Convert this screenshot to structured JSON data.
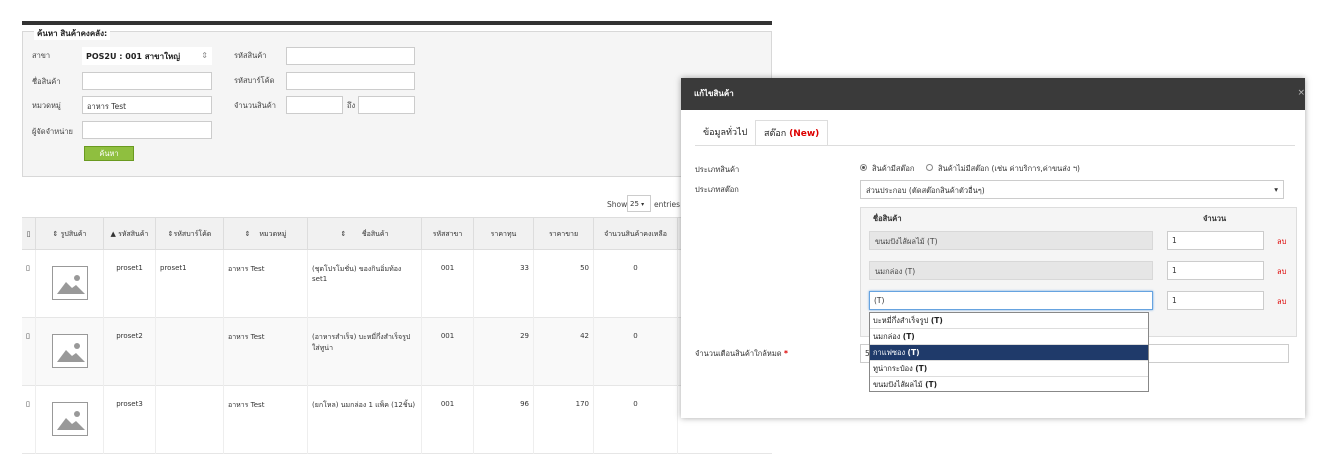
{
  "search": {
    "legend": "ค้นหา สินค้าคงคลัง:",
    "branch_label": "สาขา",
    "branch_value": "POS2U : 001 สาขาใหญ่",
    "name_label": "ชื่อสินค้า",
    "category_label": "หมวดหมู่",
    "category_value": "อาหาร Test",
    "supplier_label": "ผู้จัดจำหน่าย",
    "code_label": "รหัสสินค้า",
    "barcode_label": "รหัสบาร์โค้ด",
    "qty_label": "จำนวนสินค้า",
    "to_label": "ถึง",
    "search_button": "ค้นหา"
  },
  "table": {
    "show_label": "Show",
    "page_size": "25",
    "entries_label": "entries",
    "columns": [
      "รูปสินค้า",
      "รหัสสินค้า",
      "รหัสบาร์โค้ด",
      "หมวดหมู่",
      "ชื่อสินค้า",
      "รหัสสาขา",
      "ราคาทุน",
      "ราคาขาย",
      "จำนวนสินค้าคงเหลือ"
    ],
    "rows": [
      {
        "code": "proset1",
        "barcode": "proset1",
        "category": "อาหาร Test",
        "name": "(ชุดโปรโมชั่น) ของกินอิ่มท้อง set1",
        "branch": "001",
        "cost": "33",
        "price": "50",
        "stock": "0"
      },
      {
        "code": "proset2",
        "barcode": "",
        "category": "อาหาร Test",
        "name": "(อาหารสำเร็จ) บะหมี่กึ่งสำเร็จรูปใส่ทูน่า",
        "branch": "001",
        "cost": "29",
        "price": "42",
        "stock": "0"
      },
      {
        "code": "proset3",
        "barcode": "",
        "category": "อาหาร Test",
        "name": "(ยกโหล) นมกล่อง 1 แพ็ค (12ชิ้น)",
        "branch": "001",
        "cost": "96",
        "price": "170",
        "stock": "0"
      }
    ]
  },
  "modal": {
    "title": "แก้ไขสินค้า",
    "close": "×",
    "tab_general": "ข้อมูลทั่วไป",
    "tab_stock": "สต๊อก",
    "tab_stock_new": "(New)",
    "type_label": "ประเภทสินค้า",
    "radio_has_stock": "สินค้ามีสต๊อก",
    "radio_no_stock": "สินค้าไม่มีสต๊อก (เช่น ค่าบริการ,ค่าขนส่ง ฯ)",
    "stock_type_label": "ประเภทสต๊อก",
    "stock_type_value": "ส่วนประกอบ (ตัดสต๊อกสินค้าตัวอื่นๆ)",
    "col_product": "ชื่อสินค้า",
    "col_qty": "จำนวน",
    "components": [
      {
        "name": "ขนมปังไส้ผลไม้ (T)",
        "qty": "1",
        "delete": "ลบ"
      },
      {
        "name": "นมกล่อง (T)",
        "qty": "1",
        "delete": "ลบ"
      },
      {
        "name": "(T)",
        "qty": "1",
        "delete": "ลบ"
      }
    ],
    "alert_label": "จำนวนเตือนสินค้าใกล้หมด",
    "required_mark": "*",
    "alert_value": "5",
    "dropdown": [
      {
        "name": "บะหมี่กึ่งสำเร็จรูป",
        "tag": "(T)"
      },
      {
        "name": "นมกล่อง",
        "tag": "(T)"
      },
      {
        "name": "กาแฟซอง",
        "tag": "(T)"
      },
      {
        "name": "ทูน่ากระป๋อง",
        "tag": "(T)"
      },
      {
        "name": "ขนมปังไส้ผลไม้",
        "tag": "(T)"
      }
    ],
    "dropdown_selected_index": 2
  },
  "colors": {
    "modal_header": "#3a3a3a",
    "selected_item": "#1f3a6a",
    "delete_red": "#dd0000",
    "search_button": "#8fbf3f"
  }
}
